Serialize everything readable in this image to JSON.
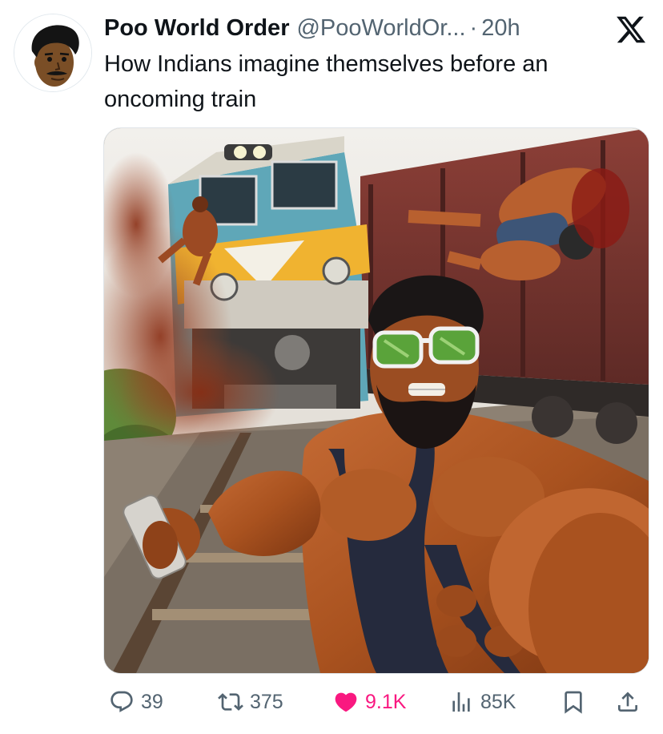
{
  "tweet": {
    "display_name": "Poo World Order",
    "handle": "@PooWorldOr...",
    "separator": "·",
    "timestamp": "20h",
    "text": "How Indians imagine themselves before an oncoming train"
  },
  "actions": {
    "replies": "39",
    "reposts": "375",
    "likes": "9.1K",
    "views": "85K"
  },
  "icons": {
    "brand": "x-logo-icon",
    "reply": "speech-bubble-icon",
    "repost": "repost-arrows-icon",
    "like": "heart-icon",
    "views": "bar-chart-icon",
    "bookmark": "bookmark-icon",
    "share": "share-upload-icon"
  },
  "colors": {
    "text_primary": "#0f1419",
    "text_secondary": "#536471",
    "like_active": "#f91880"
  }
}
